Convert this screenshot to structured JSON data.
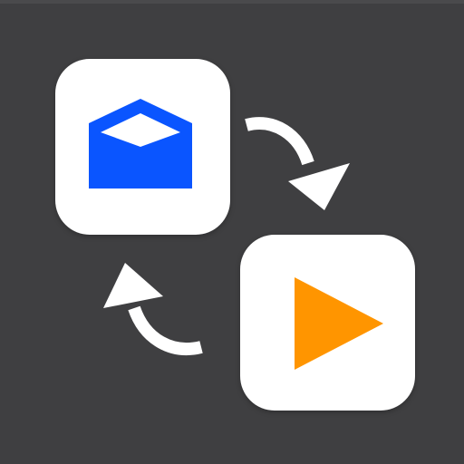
{
  "icons": {
    "mail": {
      "name": "open-envelope-icon",
      "color": "#0a55ff",
      "flap_color": "#ffffff"
    },
    "play": {
      "name": "play-icon",
      "color": "#ff9500"
    },
    "arrows": {
      "name": "curved-arrow-icon",
      "color": "#ffffff"
    }
  },
  "colors": {
    "background": "#3f3f41",
    "tile": "#ffffff"
  }
}
